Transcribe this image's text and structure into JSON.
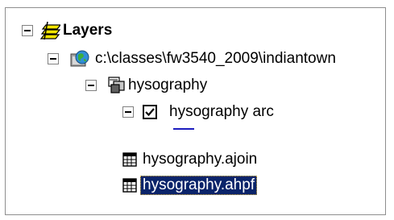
{
  "toc": {
    "root": {
      "label": "Layers",
      "expanded": true,
      "icon": "layers-icon"
    },
    "workspace": {
      "label": "c:\\classes\\fw3540_2009\\indiantown",
      "expanded": true,
      "icon": "workspace-globe-icon"
    },
    "coverage": {
      "label": "hysography",
      "expanded": true,
      "icon": "coverage-icon"
    },
    "layer": {
      "label": "hysography arc",
      "expanded": true,
      "checked": true,
      "symbol_color": "#1d1dbf"
    },
    "tables": [
      {
        "label": "hysography.ajoin",
        "selected": false,
        "icon": "table-icon"
      },
      {
        "label": "hysography.ahpf",
        "selected": true,
        "icon": "table-icon"
      }
    ]
  },
  "colors": {
    "selection_bg": "#0a246a",
    "selection_text": "#ffffff",
    "border": "#8e8e8e",
    "line_symbol": "#1d1dbf"
  }
}
